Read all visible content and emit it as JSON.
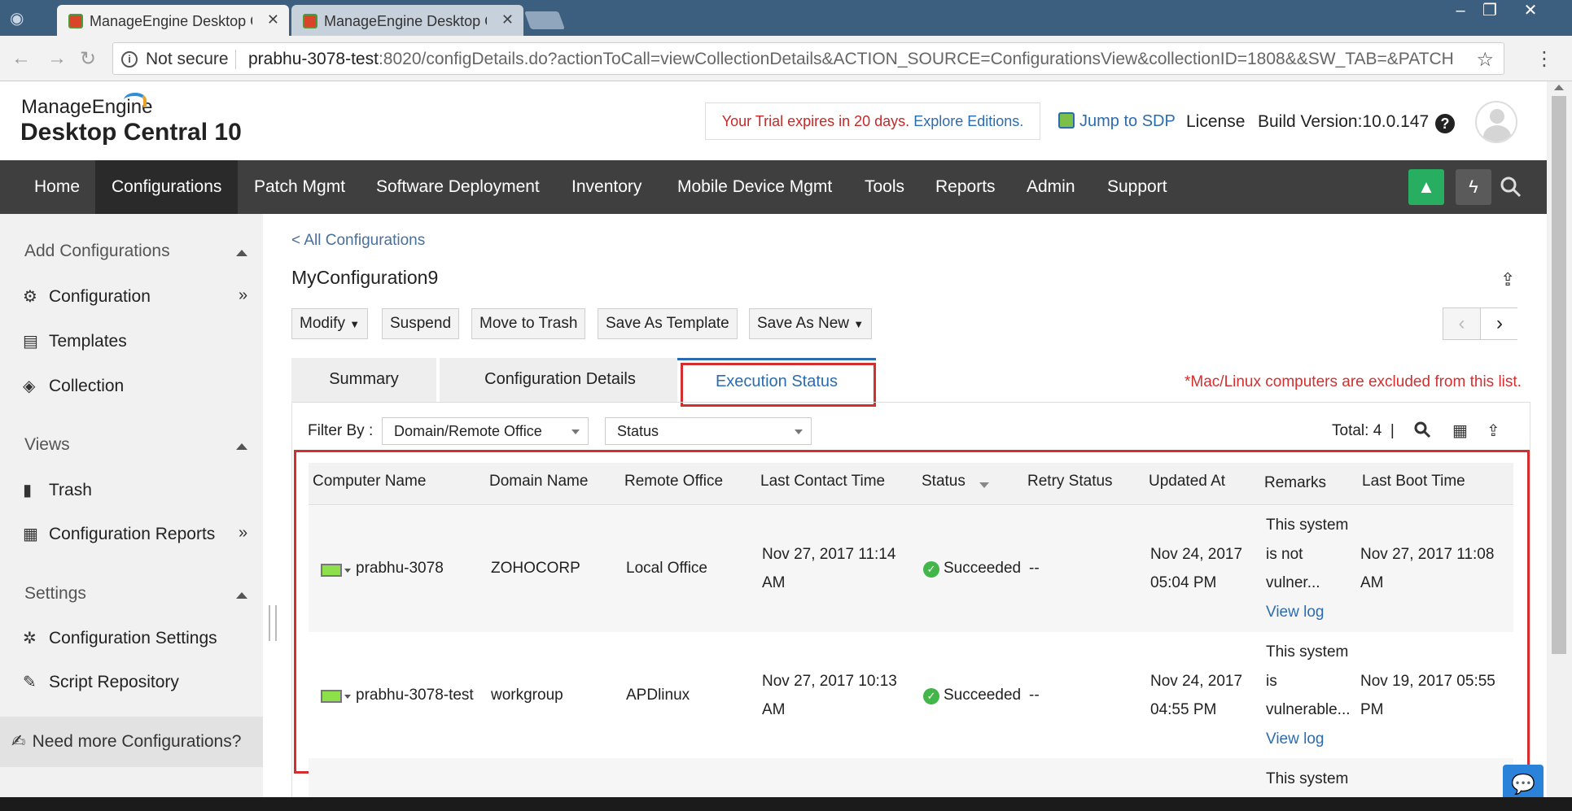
{
  "browser": {
    "tabs": [
      {
        "title": "ManageEngine Desktop C"
      },
      {
        "title": "ManageEngine Desktop C"
      }
    ],
    "security": "Not secure",
    "url_host": "prabhu-3078-test",
    "url_rest": ":8020/configDetails.do?actionToCall=viewCollectionDetails&ACTION_SOURCE=ConfigurationsView&collectionID=1808&&SW_TAB=&PATCH_TA..."
  },
  "header": {
    "logo_top": "ManageEngine",
    "logo_main": "Desktop Central 10",
    "trial_text": "Your Trial expires in 20 days.",
    "trial_link": "Explore Editions.",
    "jump_sdp": "Jump to SDP",
    "license": "License",
    "build": "Build Version:10.0.147"
  },
  "nav": {
    "items": [
      "Home",
      "Configurations",
      "Patch Mgmt",
      "Software Deployment",
      "Inventory",
      "Mobile Device Mgmt",
      "Tools",
      "Reports",
      "Admin",
      "Support"
    ],
    "active": "Configurations"
  },
  "sidebar": {
    "add_configurations": "Add Configurations",
    "configuration": "Configuration",
    "templates": "Templates",
    "collection": "Collection",
    "views": "Views",
    "trash": "Trash",
    "configuration_reports": "Configuration Reports",
    "settings": "Settings",
    "configuration_settings": "Configuration Settings",
    "script_repository": "Script Repository",
    "need_more": "Need more Configurations?"
  },
  "content": {
    "back_link": "< All Configurations",
    "title": "MyConfiguration9",
    "buttons": {
      "modify": "Modify",
      "suspend": "Suspend",
      "move_to_trash": "Move to Trash",
      "save_as_template": "Save As Template",
      "save_as_new": "Save As New"
    },
    "tabs": {
      "summary": "Summary",
      "details": "Configuration Details",
      "execution": "Execution Status"
    },
    "mac_note": "*Mac/Linux computers are excluded from this list.",
    "filter_by": "Filter By :",
    "filter_domain": "Domain/Remote Office",
    "filter_status": "Status",
    "total": "Total: 4",
    "columns": [
      "Computer Name",
      "Domain Name",
      "Remote Office",
      "Last Contact Time",
      "Status",
      "Retry Status",
      "Updated At",
      "Remarks",
      "Last Boot Time"
    ],
    "rows": [
      {
        "computer": "prabhu-3078",
        "domain": "ZOHOCORP",
        "office": "Local Office",
        "contact_l1": "Nov 27, 2017 11:14",
        "contact_l2": "AM",
        "status": "Succeeded",
        "retry": "--",
        "updated_l1": "Nov 24, 2017",
        "updated_l2": "05:04 PM",
        "remarks_l1": "This system",
        "remarks_l2": "is not",
        "remarks_l3": "vulner...",
        "view_log": "View log",
        "boot_l1": "Nov 27, 2017 11:08",
        "boot_l2": "AM"
      },
      {
        "computer": "prabhu-3078-test",
        "domain": "workgroup",
        "office": "APDlinux",
        "contact_l1": "Nov 27, 2017 10:13",
        "contact_l2": "AM",
        "status": "Succeeded",
        "retry": "--",
        "updated_l1": "Nov 24, 2017",
        "updated_l2": "04:55 PM",
        "remarks_l1": "This system",
        "remarks_l2": "is",
        "remarks_l3": "vulnerable...",
        "view_log": "View log",
        "boot_l1": "Nov 19, 2017 05:55",
        "boot_l2": "PM"
      },
      {
        "remarks_l1": "This system"
      }
    ]
  }
}
